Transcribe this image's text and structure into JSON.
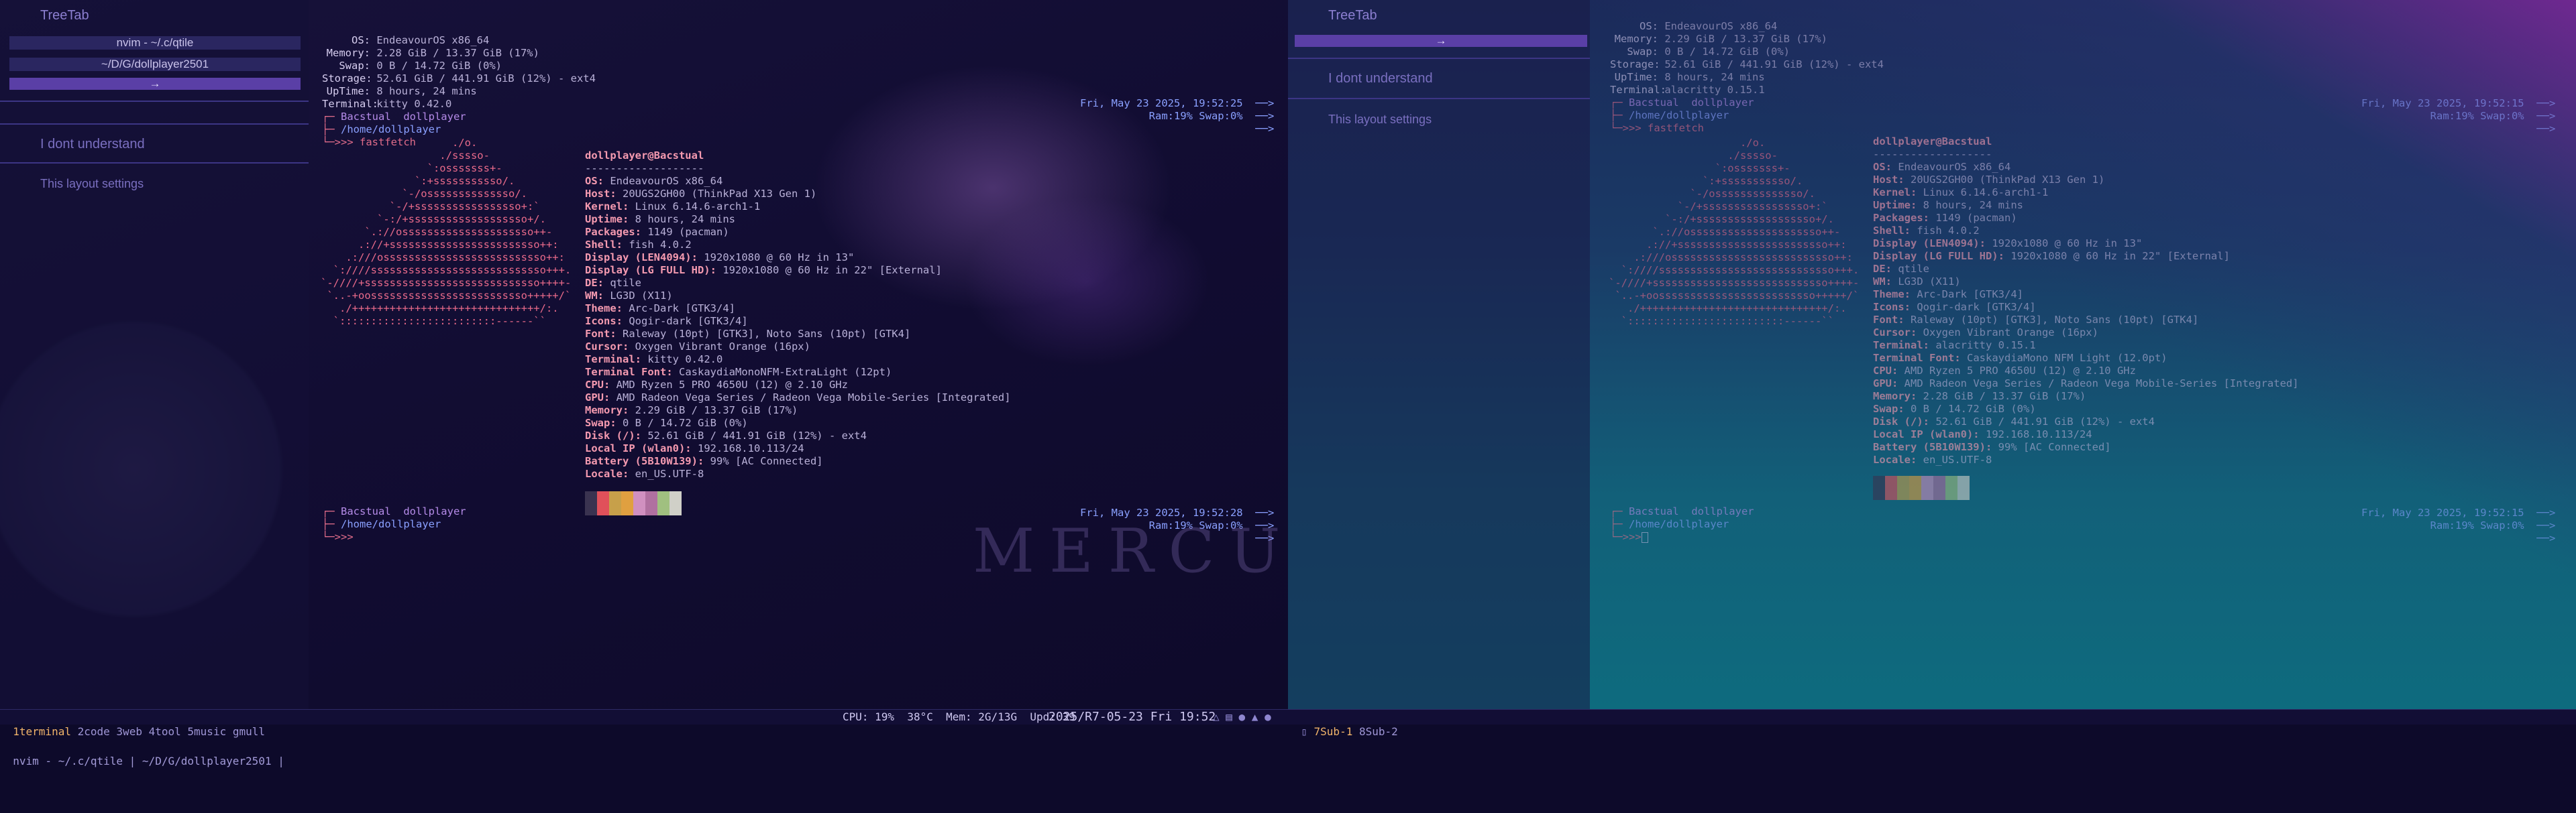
{
  "left_screen": {
    "treetab": {
      "title": "TreeTab",
      "items": [
        "nvim - ~/.c/qtile",
        "~/D/G/dollplayer2501",
        "→"
      ],
      "groups": [
        "I dont understand",
        "This layout settings"
      ]
    },
    "term_top": {
      "info": [
        {
          "label": "OS:",
          "value": "EndeavourOS x86_64"
        },
        {
          "label": "Memory:",
          "value": "2.28 GiB / 13.37 GiB (17%)"
        },
        {
          "label": "Swap:",
          "value": "0 B / 14.72 GiB (0%)"
        },
        {
          "label": "Storage:",
          "value": "52.61 GiB / 441.91 GiB (12%) - ext4"
        },
        {
          "label": "UpTime:",
          "value": "8 hours, 24 mins"
        },
        {
          "label": "Terminal:",
          "value": "kitty 0.42.0"
        }
      ],
      "prompt_user": "Bacstual  dollplayer",
      "prompt_path": "/home/dollplayer",
      "prompt_cmd": ">>> fastfetch",
      "right_time": "Fri, May 23 2025, 19:52:25  ──>",
      "right_mem": "Ram:19% Swap:0%  ──>",
      "right_arrow": "──>"
    },
    "fastfetch": {
      "ascii": [
        "                     ./o.",
        "                   ./sssso-",
        "                 `:osssssss+-",
        "               `:+sssssssssso/.",
        "             `-/ossssssssssssso/.",
        "           `-/+sssssssssssssssso+:`",
        "         `-:/+sssssssssssssssssso+/.",
        "       `.://osssssssssssssssssssso++-",
        "      .://+ssssssssssssssssssssssso++:",
        "    .:///ossssssssssssssssssssssssso++:",
        "  `:////ssssssssssssssssssssssssssso+++.",
        "`-////+ssssssssssssssssssssssssssso++++-",
        " `..-+oosssssssssssssssssssssssso+++++/`",
        "   ./++++++++++++++++++++++++++++++/:.",
        "  `:::::::::::::::::::::::::------``"
      ],
      "header": "dollplayer@Bacstual",
      "separator": "-------------------",
      "rows": [
        {
          "label": "OS:",
          "value": "EndeavourOS x86_64"
        },
        {
          "label": "Host:",
          "value": "20UGS2GH00 (ThinkPad X13 Gen 1)"
        },
        {
          "label": "Kernel:",
          "value": "Linux 6.14.6-arch1-1"
        },
        {
          "label": "Uptime:",
          "value": "8 hours, 24 mins"
        },
        {
          "label": "Packages:",
          "value": "1149 (pacman)"
        },
        {
          "label": "Shell:",
          "value": "fish 4.0.2"
        },
        {
          "label": "Display (LEN4094):",
          "value": "1920x1080 @ 60 Hz in 13\""
        },
        {
          "label": "Display (LG FULL HD):",
          "value": "1920x1080 @ 60 Hz in 22\" [External]"
        },
        {
          "label": "DE:",
          "value": "qtile"
        },
        {
          "label": "WM:",
          "value": "LG3D (X11)"
        },
        {
          "label": "Theme:",
          "value": "Arc-Dark [GTK3/4]"
        },
        {
          "label": "Icons:",
          "value": "Qogir-dark [GTK3/4]"
        },
        {
          "label": "Font:",
          "value": "Raleway (10pt) [GTK3], Noto Sans (10pt) [GTK4]"
        },
        {
          "label": "Cursor:",
          "value": "Oxygen Vibrant Orange (16px)"
        },
        {
          "label": "Terminal:",
          "value": "kitty 0.42.0"
        },
        {
          "label": "Terminal Font:",
          "value": "CaskaydiaMonoNFM-ExtraLight (12pt)"
        },
        {
          "label": "CPU:",
          "value": "AMD Ryzen 5 PRO 4650U (12) @ 2.10 GHz"
        },
        {
          "label": "GPU:",
          "value": "AMD Radeon Vega Series / Radeon Vega Mobile-Series [Integrated]"
        },
        {
          "label": "Memory:",
          "value": "2.29 GiB / 13.37 GiB (17%)"
        },
        {
          "label": "Swap:",
          "value": "0 B / 14.72 GiB (0%)"
        },
        {
          "label": "Disk (/):",
          "value": "52.61 GiB / 441.91 GiB (12%) - ext4"
        },
        {
          "label": "Local IP (wlan0):",
          "value": "192.168.10.113/24"
        },
        {
          "label": "Battery (5B10W139):",
          "value": "99% [AC Connected]"
        },
        {
          "label": "Locale:",
          "value": "en_US.UTF-8"
        }
      ],
      "palette": [
        "#3a3350",
        "#e0505a",
        "#c7a04a",
        "#e0a040",
        "#d090c0",
        "#b070a0",
        "#a0c080",
        "#d0d0c8"
      ]
    },
    "term_bottom": {
      "prompt_user": "Bacstual  dollplayer",
      "prompt_path": "/home/dollplayer",
      "prompt_cmd": ">>>",
      "right_time": "Fri, May 23 2025, 19:52:28  ──>",
      "right_mem": "Ram:19% Swap:0%  ──>",
      "right_arrow": "──>"
    },
    "watermark": "MERCURY"
  },
  "right_screen": {
    "treetab": {
      "title": "TreeTab",
      "items": [
        "→"
      ],
      "groups": [
        "I dont understand",
        "This layout settings"
      ]
    },
    "term_top": {
      "info": [
        {
          "label": "OS:",
          "value": "EndeavourOS x86_64"
        },
        {
          "label": "Memory:",
          "value": "2.29 GiB / 13.37 GiB (17%)"
        },
        {
          "label": "Swap:",
          "value": "0 B / 14.72 GiB (0%)"
        },
        {
          "label": "Storage:",
          "value": "52.61 GiB / 441.91 GiB (12%) - ext4"
        },
        {
          "label": "UpTime:",
          "value": "8 hours, 24 mins"
        },
        {
          "label": "Terminal:",
          "value": "alacritty 0.15.1"
        }
      ],
      "prompt_user": "Bacstual  dollplayer",
      "prompt_path": "/home/dollplayer",
      "prompt_cmd": ">>> fastfetch",
      "right_time": "Fri, May 23 2025, 19:52:15  ──>",
      "right_mem": "Ram:19% Swap:0%  ──>",
      "right_arrow": "──>"
    },
    "fastfetch_rows": [
      {
        "label": "OS:",
        "value": "EndeavourOS x86_64"
      },
      {
        "label": "Host:",
        "value": "20UGS2GH00 (ThinkPad X13 Gen 1)"
      },
      {
        "label": "Kernel:",
        "value": "Linux 6.14.6-arch1-1"
      },
      {
        "label": "Uptime:",
        "value": "8 hours, 24 mins"
      },
      {
        "label": "Packages:",
        "value": "1149 (pacman)"
      },
      {
        "label": "Shell:",
        "value": "fish 4.0.2"
      },
      {
        "label": "Display (LEN4094):",
        "value": "1920x1080 @ 60 Hz in 13\""
      },
      {
        "label": "Display (LG FULL HD):",
        "value": "1920x1080 @ 60 Hz in 22\" [External]"
      },
      {
        "label": "DE:",
        "value": "qtile"
      },
      {
        "label": "WM:",
        "value": "LG3D (X11)"
      },
      {
        "label": "Theme:",
        "value": "Arc-Dark [GTK3/4]"
      },
      {
        "label": "Icons:",
        "value": "Qogir-dark [GTK3/4]"
      },
      {
        "label": "Font:",
        "value": "Raleway (10pt) [GTK3], Noto Sans (10pt) [GTK4]"
      },
      {
        "label": "Cursor:",
        "value": "Oxygen Vibrant Orange (16px)"
      },
      {
        "label": "Terminal:",
        "value": "alacritty 0.15.1"
      },
      {
        "label": "Terminal Font:",
        "value": "CaskaydiaMono NFM Light (12.0pt)"
      },
      {
        "label": "CPU:",
        "value": "AMD Ryzen 5 PRO 4650U (12) @ 2.10 GHz"
      },
      {
        "label": "GPU:",
        "value": "AMD Radeon Vega Series / Radeon Vega Mobile-Series [Integrated]"
      },
      {
        "label": "Memory:",
        "value": "2.28 GiB / 13.37 GiB (17%)"
      },
      {
        "label": "Swap:",
        "value": "0 B / 14.72 GiB (0%)"
      },
      {
        "label": "Disk (/):",
        "value": "52.61 GiB / 441.91 GiB (12%) - ext4"
      },
      {
        "label": "Local IP (wlan0):",
        "value": "192.168.10.113/24"
      },
      {
        "label": "Battery (5B10W139):",
        "value": "99% [AC Connected]"
      },
      {
        "label": "Locale:",
        "value": "en_US.UTF-8"
      }
    ],
    "term_bottom": {
      "prompt_user": "Bacstual  dollplayer",
      "prompt_path": "/home/dollplayer",
      "prompt_cmd": ">>>",
      "right_time": "Fri, May 23 2025, 19:52:15  ──>",
      "right_mem": "Ram:19% Swap:0%  ──>",
      "right_arrow": "──>"
    }
  },
  "bar_left": {
    "workspaces": [
      "1terminal",
      "2code",
      "3web",
      "4tool",
      "5music",
      "gmull"
    ],
    "current_index": 0,
    "window_title": "nvim - ~/.c/qtile | ~/D/G/dollplayer2501 |",
    "stats": "CPU: 19%  38°C  Mem: 2G/13G  Upd: 39",
    "clock": "2025/R7-05-23 Fri 19:52",
    "tray": "△ ▤ ● ▲ ●"
  },
  "bar_right": {
    "workspaces": [
      "7Sub-1",
      "8Sub-2"
    ],
    "current_index": 0
  },
  "colors": {
    "accent": "#5a3fa6",
    "workspace_current": "#f1b46a",
    "prompt_red": "#e06c8a"
  }
}
